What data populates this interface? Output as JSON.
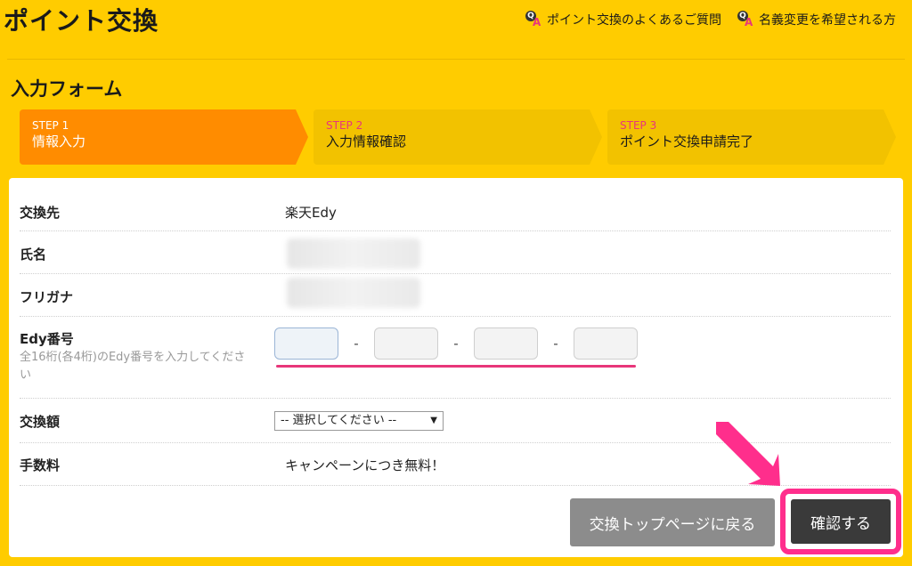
{
  "header": {
    "title": "ポイント交換",
    "links": [
      {
        "icon": "qa-icon",
        "label": "ポイント交換のよくあるご質問"
      },
      {
        "icon": "qa-icon",
        "label": "名義変更を希望される方"
      }
    ]
  },
  "form": {
    "title": "入力フォーム",
    "steps": [
      {
        "num": "STEP 1",
        "label": "情報入力",
        "active": true
      },
      {
        "num": "STEP 2",
        "label": "入力情報確認",
        "active": false
      },
      {
        "num": "STEP 3",
        "label": "ポイント交換申請完了",
        "active": false
      }
    ],
    "rows": {
      "exchange_to": {
        "label": "交換先",
        "value": "楽天Edy"
      },
      "name": {
        "label": "氏名"
      },
      "furigana": {
        "label": "フリガナ"
      },
      "edy": {
        "label": "Edy番号",
        "hint": "全16桁(各4桁)のEdy番号を入力してください",
        "fields": [
          "",
          "",
          "",
          ""
        ],
        "separator": "-"
      },
      "amount": {
        "label": "交換額",
        "selected": "-- 選択してください --"
      },
      "fee": {
        "label": "手数料",
        "value": "キャンペーンにつき無料！"
      }
    },
    "buttons": {
      "back": "交換トップページに戻る",
      "confirm": "確認する"
    }
  },
  "colors": {
    "background": "#ffcc00",
    "active_step": "#ff8c00",
    "highlight": "#ff2e8c"
  }
}
